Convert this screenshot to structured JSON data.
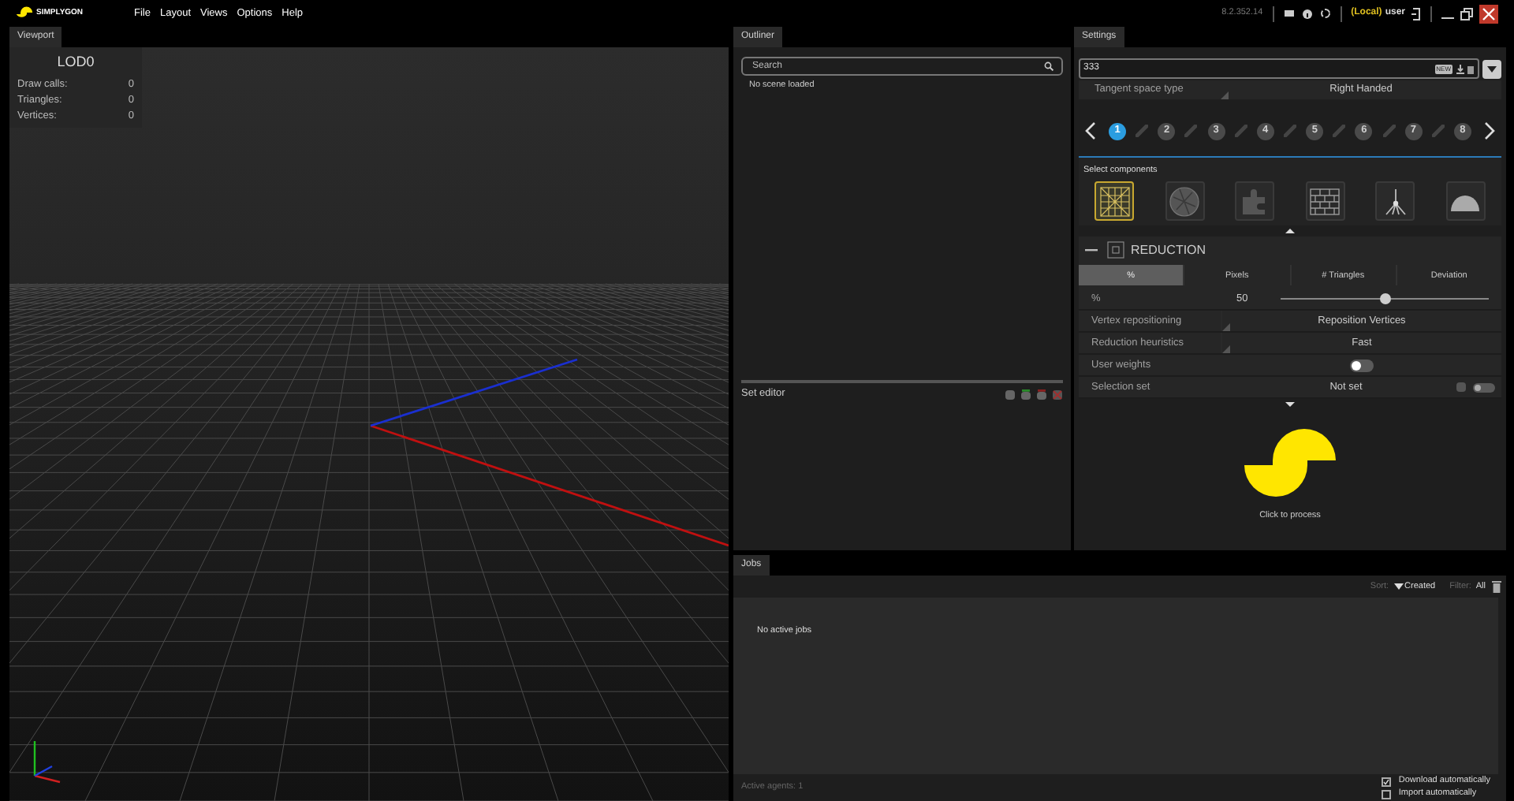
{
  "app": {
    "logo_text": "SIMPLYGON",
    "menu": [
      "File",
      "Layout",
      "Views",
      "Options",
      "Help"
    ],
    "version": "8.2.352.14",
    "user_prefix": "(Local)",
    "user": "user"
  },
  "viewport": {
    "tab": "Viewport",
    "lod_title": "LOD0",
    "stats": [
      {
        "label": "Draw calls:",
        "value": "0"
      },
      {
        "label": "Triangles:",
        "value": "0"
      },
      {
        "label": "Vertices:",
        "value": "0"
      }
    ]
  },
  "outliner": {
    "tab": "Outliner",
    "search_placeholder": "Search",
    "empty_text": "No scene loaded",
    "set_editor": "Set editor"
  },
  "settings": {
    "tab": "Settings",
    "pipeline": "333",
    "new_badge": "NEW",
    "tangent": {
      "label": "Tangent space type",
      "value": "Right Handed"
    },
    "lod_steps": [
      {
        "label": "1",
        "selected": true
      },
      {
        "label": "2",
        "selected": false
      },
      {
        "label": "3",
        "selected": false
      },
      {
        "label": "4",
        "selected": false
      },
      {
        "label": "5",
        "selected": false
      },
      {
        "label": "6",
        "selected": false
      },
      {
        "label": "7",
        "selected": false
      },
      {
        "label": "8",
        "selected": false
      }
    ],
    "components_label": "Select components",
    "components": [
      {
        "kind": "grid",
        "selected": true
      },
      {
        "kind": "sphere",
        "selected": false
      },
      {
        "kind": "puzzle",
        "selected": false
      },
      {
        "kind": "brick",
        "selected": false
      },
      {
        "kind": "tree",
        "selected": false
      },
      {
        "kind": "dome",
        "selected": false
      }
    ],
    "section_title": "REDUCTION",
    "target_tabs": [
      {
        "label": "%",
        "selected": true
      },
      {
        "label": "Pixels",
        "selected": false
      },
      {
        "label": "# Triangles",
        "selected": false
      },
      {
        "label": "Deviation",
        "selected": false
      }
    ],
    "rows": [
      {
        "kind": "slider",
        "label": "%",
        "reading": "50",
        "level": 0.5
      },
      {
        "kind": "select",
        "label": "Vertex repositioning",
        "value": "Reposition Vertices"
      },
      {
        "kind": "select",
        "label": "Reduction heuristics",
        "value": "Fast"
      },
      {
        "kind": "toggle",
        "label": "User weights",
        "on": false
      },
      {
        "kind": "set",
        "label": "Selection set",
        "value": "Not set",
        "on": false
      }
    ],
    "process_label": "Click to process"
  },
  "jobs": {
    "tab": "Jobs",
    "sort_label": "Sort:",
    "sort_value": "Created",
    "filter_label": "Filter:",
    "filter_value": "All",
    "empty_text": "No active jobs",
    "agents": "Active agents: 1",
    "options": [
      {
        "label": "Download automatically",
        "checked": true
      },
      {
        "label": "Import automatically",
        "checked": false
      }
    ]
  }
}
